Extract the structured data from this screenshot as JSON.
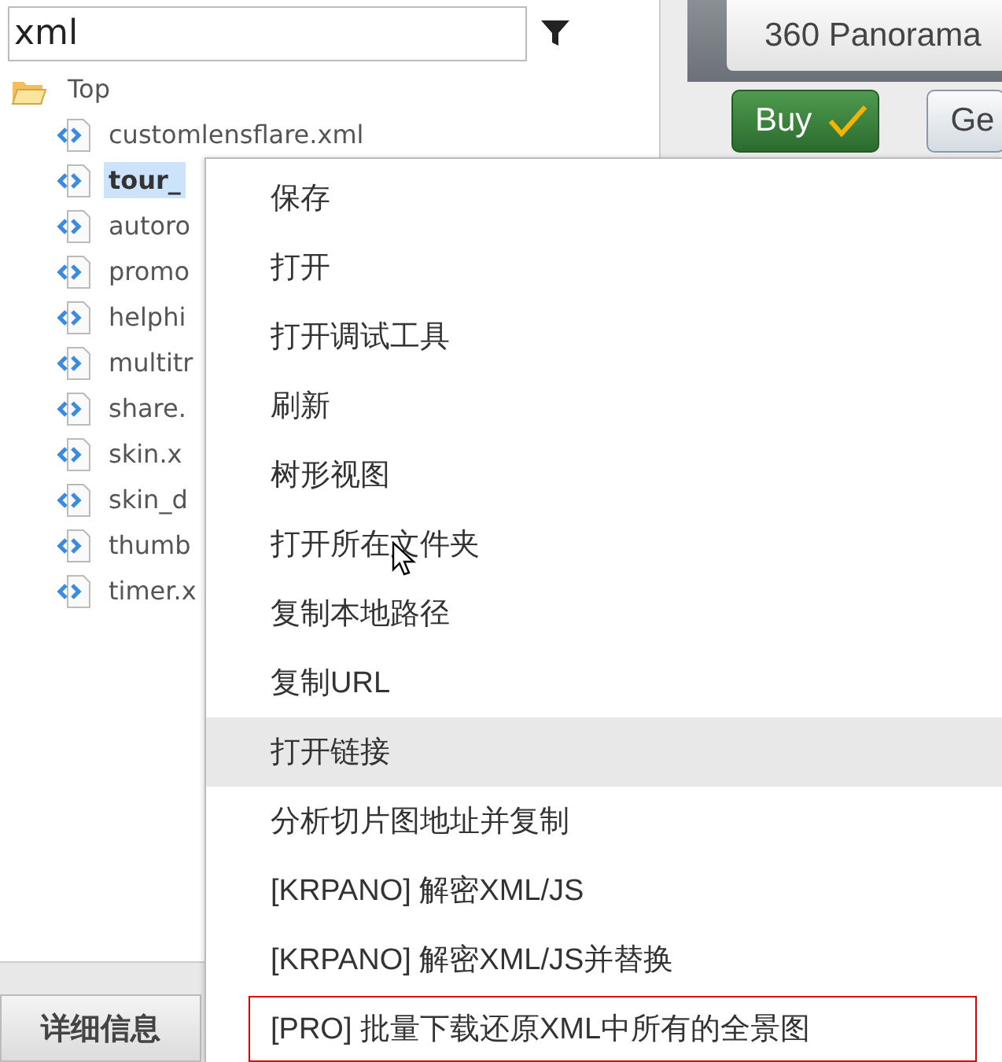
{
  "search": {
    "value": "xml"
  },
  "tree": [
    {
      "label": "Top",
      "children": [
        {
          "label": "customlensflare.xml",
          "selected": false
        },
        {
          "label": "tour_",
          "selected": true
        },
        {
          "label": "autoro",
          "selected": false
        },
        {
          "label": "promo",
          "selected": false
        },
        {
          "label": "helphi",
          "selected": false
        },
        {
          "label": "multitr",
          "selected": false
        },
        {
          "label": "share.",
          "selected": false
        },
        {
          "label": "skin.x",
          "selected": false
        },
        {
          "label": "skin_d",
          "selected": false
        },
        {
          "label": "thumb",
          "selected": false
        },
        {
          "label": "timer.x",
          "selected": false
        }
      ]
    }
  ],
  "details_button": "详细信息",
  "toolbar": {
    "title_button": "360 Panorama",
    "buy_button": "Buy",
    "button_3": "Ge"
  },
  "context_menu": {
    "items": [
      {
        "label": "保存",
        "selected": false
      },
      {
        "label": "打开",
        "selected": false
      },
      {
        "label": "打开调试工具",
        "selected": false
      },
      {
        "label": "刷新",
        "selected": false
      },
      {
        "label": "树形视图",
        "selected": false
      },
      {
        "label": "打开所在文件夹",
        "selected": false
      },
      {
        "label": "复制本地路径",
        "selected": false
      },
      {
        "label": "复制URL",
        "selected": false
      },
      {
        "label": "打开链接",
        "selected": true
      },
      {
        "label": "分析切片图地址并复制",
        "selected": false
      },
      {
        "label": "[KRPANO] 解密XML/JS",
        "selected": false
      },
      {
        "label": "[KRPANO] 解密XML/JS并替换",
        "selected": false
      },
      {
        "label": "[PRO] 批量下载还原XML中所有的全景图",
        "selected": false
      }
    ]
  }
}
